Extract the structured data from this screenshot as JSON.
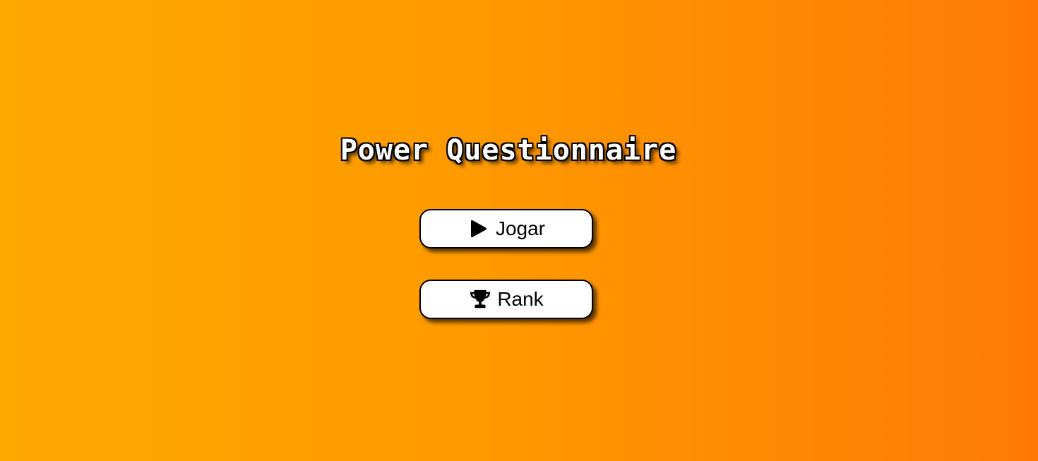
{
  "title": "Power Questionnaire",
  "menu": {
    "play": {
      "label": "Jogar",
      "icon": "play-icon"
    },
    "rank": {
      "label": "Rank",
      "icon": "trophy-icon"
    }
  },
  "colors": {
    "background_start": "#ffa800",
    "background_end": "#ff7a05",
    "button_bg": "#ffffff",
    "button_border": "#000000"
  }
}
